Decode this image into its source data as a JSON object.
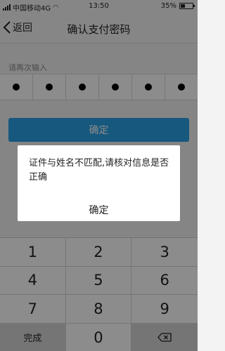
{
  "status_bar": {
    "carrier": "中国移动4G",
    "time": "13:50",
    "battery_text": "35%",
    "battery_level": 0.35
  },
  "nav": {
    "back_label": "返回",
    "title": "确认支付密码"
  },
  "pin": {
    "prompt": "请再次输入",
    "length": 6,
    "filled": 6
  },
  "confirm_button": {
    "label": "确定"
  },
  "keypad": {
    "keys": [
      "1",
      "2",
      "3",
      "4",
      "5",
      "6",
      "7",
      "8",
      "9",
      "完成",
      "0"
    ],
    "delete_icon": "backspace-icon"
  },
  "dialog": {
    "message": "证件与姓名不匹配,请核对信息是否正确",
    "ok_label": "确定"
  },
  "colors": {
    "accent": "#2ba0e6",
    "overlay": "rgba(0,0,0,0.45)"
  }
}
